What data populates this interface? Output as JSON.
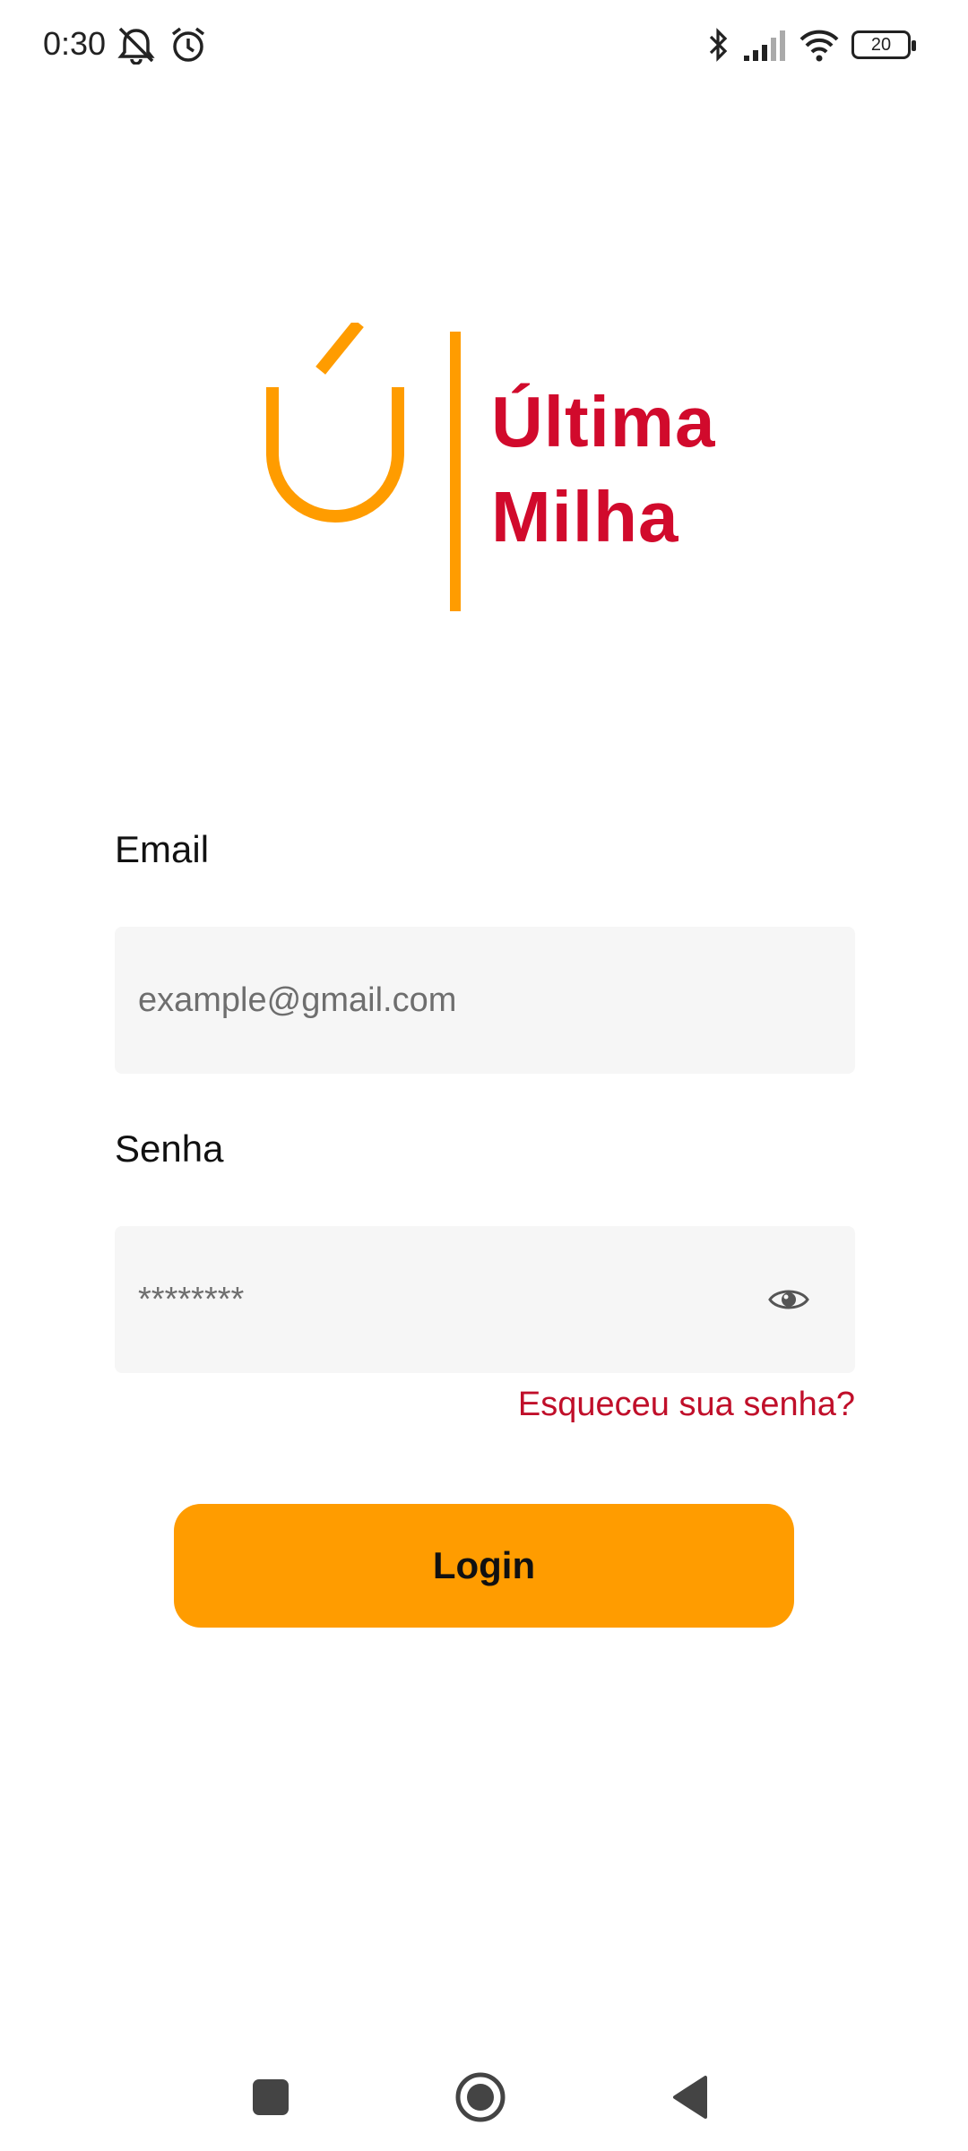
{
  "status_bar": {
    "time": "0:30",
    "battery_level": "20",
    "icons": [
      "mute-icon",
      "alarm-icon",
      "bluetooth-icon",
      "signal-icon",
      "wifi-icon",
      "battery-icon"
    ]
  },
  "logo": {
    "line1": "Última",
    "line2": "Milha",
    "colors": {
      "mark": "#ff9c00",
      "text": "#d10a2c"
    }
  },
  "form": {
    "email_label": "Email",
    "email_placeholder": "example@gmail.com",
    "email_value": "",
    "password_label": "Senha",
    "password_placeholder": "********",
    "password_value": "",
    "forgot_link": "Esqueceu sua senha?",
    "login_label": "Login"
  },
  "navigation": {
    "buttons": [
      "recents-icon",
      "home-icon",
      "back-icon"
    ]
  },
  "colors": {
    "accent": "#ff9c00",
    "link": "#c00f2a",
    "input_bg": "#f6f6f6"
  }
}
